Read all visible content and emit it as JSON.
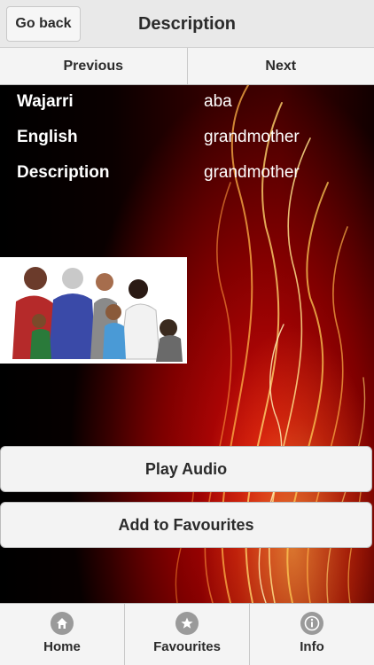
{
  "header": {
    "back_label": "Go back",
    "title": "Description"
  },
  "nav": {
    "previous_label": "Previous",
    "next_label": "Next"
  },
  "entry": {
    "rows": [
      {
        "key": "Wajarri",
        "value": "aba"
      },
      {
        "key": "English",
        "value": "grandmother"
      },
      {
        "key": "Description",
        "value": "grandmother"
      }
    ]
  },
  "actions": {
    "play_audio": "Play Audio",
    "add_favourites": "Add to Favourites"
  },
  "tabs": [
    {
      "label": "Home",
      "icon": "home-icon"
    },
    {
      "label": "Favourites",
      "icon": "star-icon"
    },
    {
      "label": "Info",
      "icon": "info-icon"
    }
  ],
  "colors": {
    "accent_red": "#c40000",
    "flame_yellow": "#ffd24a"
  }
}
